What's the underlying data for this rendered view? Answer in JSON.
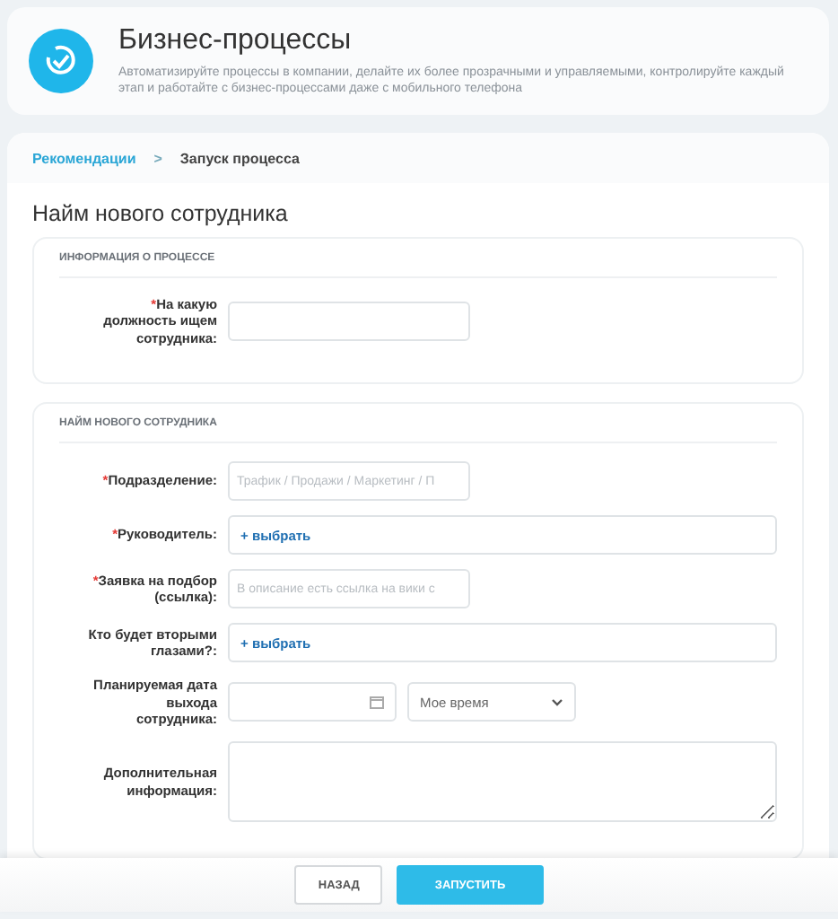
{
  "header": {
    "title": "Бизнес-процессы",
    "description": "Автоматизируйте процессы в компании, делайте их более прозрачными и управляемыми, контролируйте каждый этап и работайте с бизнес-процессами даже с мобильного телефона"
  },
  "breadcrumbs": [
    {
      "label": "Рекомендации",
      "kind": "link"
    },
    {
      "label": "Запуск процесса",
      "kind": "current"
    }
  ],
  "breadcrumb_separator": ">",
  "page_title": "Найм нового сотрудника",
  "sections": [
    {
      "title": "ИНФОРМАЦИЯ О ПРОЦЕССЕ",
      "fields": [
        {
          "kind": "text",
          "label": "На какую должность ищем сотрудника:",
          "required": true
        }
      ]
    },
    {
      "title": "НАЙМ НОВОГО СОТРУДНИКА",
      "fields": [
        {
          "kind": "text",
          "label": "Подразделение:",
          "required": true,
          "placeholder": "Трафик / Продажи / Маркетинг / П"
        },
        {
          "kind": "picker",
          "label": "Руководитель:",
          "required": true,
          "action": "+ выбрать"
        },
        {
          "kind": "text",
          "label": "Заявка на подбор (ссылка):",
          "required": true,
          "placeholder": "В описание есть ссылка на вики с"
        },
        {
          "kind": "picker",
          "label": "Кто будет вторыми глазами?:",
          "required": false,
          "action": "+ выбрать"
        },
        {
          "kind": "datetime",
          "label": "Планируемая дата выхода сотрудника:",
          "required": false,
          "time_value": "Мое время"
        },
        {
          "kind": "textarea",
          "label": "Дополнительная информация:",
          "required": false
        }
      ]
    }
  ],
  "required_mark": "*",
  "buttons": [
    {
      "label": "НАЗАД",
      "kind": "secondary"
    },
    {
      "label": "ЗАПУСТИТЬ",
      "kind": "primary"
    }
  ]
}
